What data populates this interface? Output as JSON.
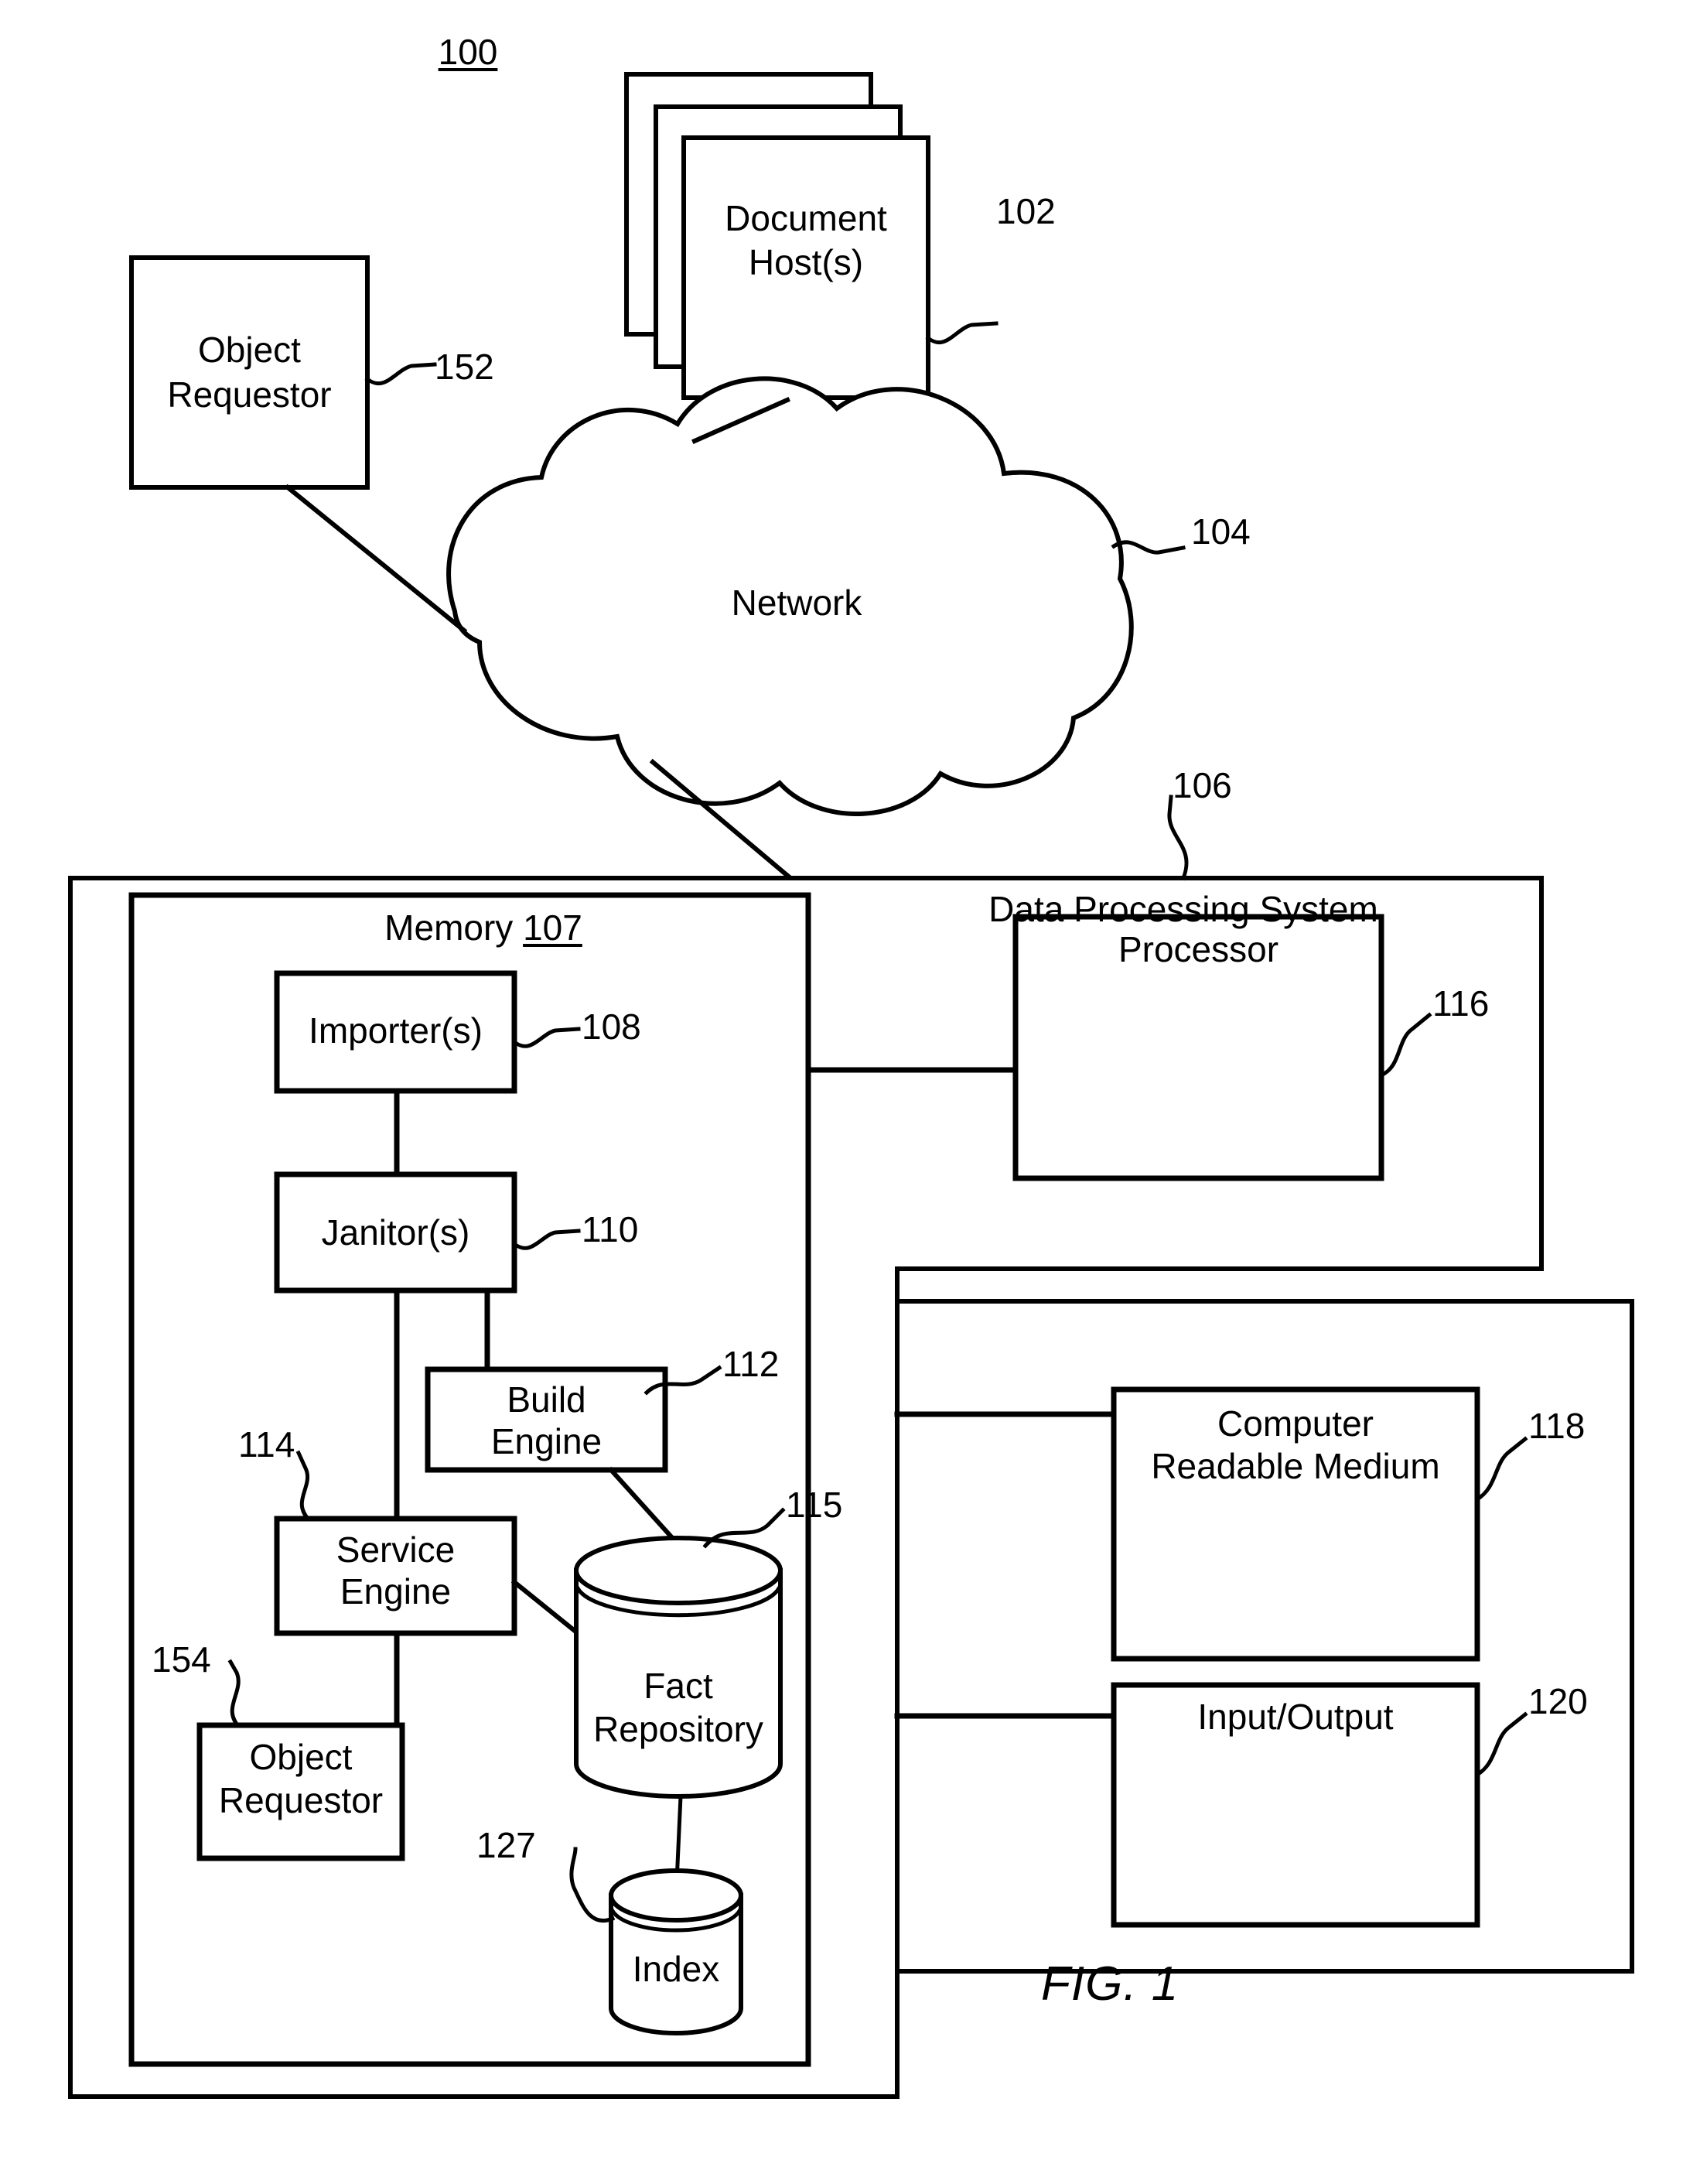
{
  "figure": {
    "id": "100",
    "caption": "FIG. 1",
    "title": "Data Processing System block diagram"
  },
  "nodes": {
    "system_ref": "100",
    "document_hosts": {
      "label": "Document\nHost(s)",
      "ref": "102"
    },
    "object_requestor_external": {
      "label": "Object\nRequestor",
      "ref": "152"
    },
    "network": {
      "label": "Network",
      "ref": "104"
    },
    "data_processing_system": {
      "label": "Data Processing System",
      "ref": "106"
    },
    "memory": {
      "label": "Memory",
      "ref": "107"
    },
    "importers": {
      "label": "Importer(s)",
      "ref": "108"
    },
    "janitors": {
      "label": "Janitor(s)",
      "ref": "110"
    },
    "build_engine": {
      "label": "Build\nEngine",
      "ref": "112"
    },
    "service_engine": {
      "label": "Service\nEngine",
      "ref": "114"
    },
    "fact_repository": {
      "label": "Fact\nRepository",
      "ref": "115"
    },
    "index": {
      "label": "Index",
      "ref": "127"
    },
    "object_requestor_internal": {
      "label": "Object\nRequestor",
      "ref": "154"
    },
    "processor": {
      "label": "Processor",
      "ref": "116"
    },
    "computer_readable_medium": {
      "label": "Computer\nReadable Medium",
      "ref": "118"
    },
    "input_output": {
      "label": "Input/Output",
      "ref": "120"
    }
  },
  "labels": {
    "ref_100": "100",
    "ref_102": "102",
    "ref_104": "104",
    "ref_106": "106",
    "ref_107": "107",
    "ref_108": "108",
    "ref_110": "110",
    "ref_112": "112",
    "ref_114": "114",
    "ref_115": "115",
    "ref_116": "116",
    "ref_118": "118",
    "ref_120": "120",
    "ref_127": "127",
    "ref_152": "152",
    "ref_154": "154",
    "document_hosts": "Document",
    "document_hosts_2": "Host(s)",
    "object_requestor_1": "Object",
    "object_requestor_2": "Requestor",
    "network": "Network",
    "data_processing_system": "Data Processing System",
    "memory_word": "Memory",
    "importers": "Importer(s)",
    "janitors": "Janitor(s)",
    "build": "Build",
    "engine": "Engine",
    "service": "Service",
    "engine2": "Engine",
    "fact": "Fact",
    "repository": "Repository",
    "index": "Index",
    "object_requestor_3": "Object",
    "object_requestor_4": "Requestor",
    "processor": "Processor",
    "crm_1": "Computer",
    "crm_2": "Readable Medium",
    "io": "Input/Output",
    "fig_caption": "FIG. 1"
  },
  "colors": {
    "line": "#000000",
    "background": "#ffffff"
  }
}
